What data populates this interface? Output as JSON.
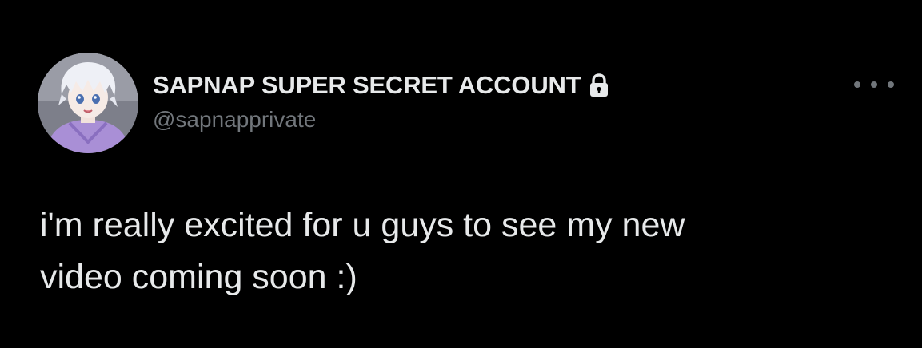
{
  "tweet": {
    "display_name": "SAPNAP SUPER SECRET ACCOUNT",
    "handle": "@sapnapprivate",
    "protected": true,
    "text": "i'm really excited for u guys to see my new\nvideo coming soon :)"
  },
  "icons": {
    "lock": "lock-icon",
    "more": "more-options-icon",
    "avatar": "profile-avatar"
  },
  "colors": {
    "background": "#000000",
    "primary_text": "#e7e9ea",
    "secondary_text": "#71767b"
  }
}
